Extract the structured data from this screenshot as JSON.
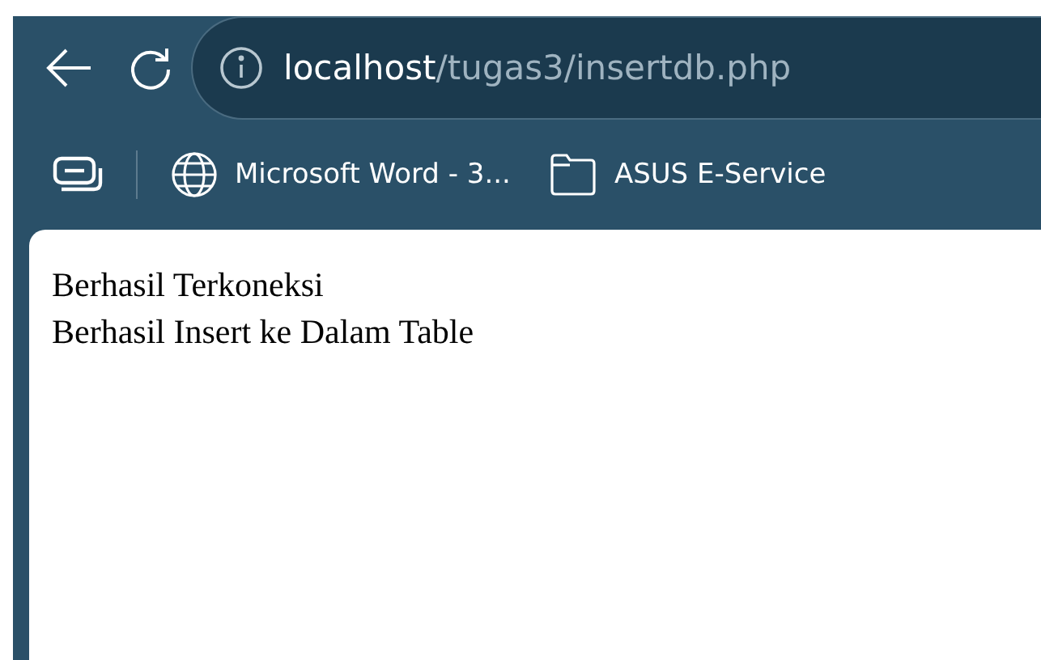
{
  "address_bar": {
    "host": "localhost",
    "path": "/tugas3/insertdb.php"
  },
  "bookmarks": [
    {
      "kind": "site",
      "label": "Microsoft Word - 3..."
    },
    {
      "kind": "folder",
      "label": "ASUS E-Service"
    }
  ],
  "page": {
    "lines": [
      "Berhasil Terkoneksi",
      "Berhasil Insert ke Dalam Table"
    ]
  }
}
